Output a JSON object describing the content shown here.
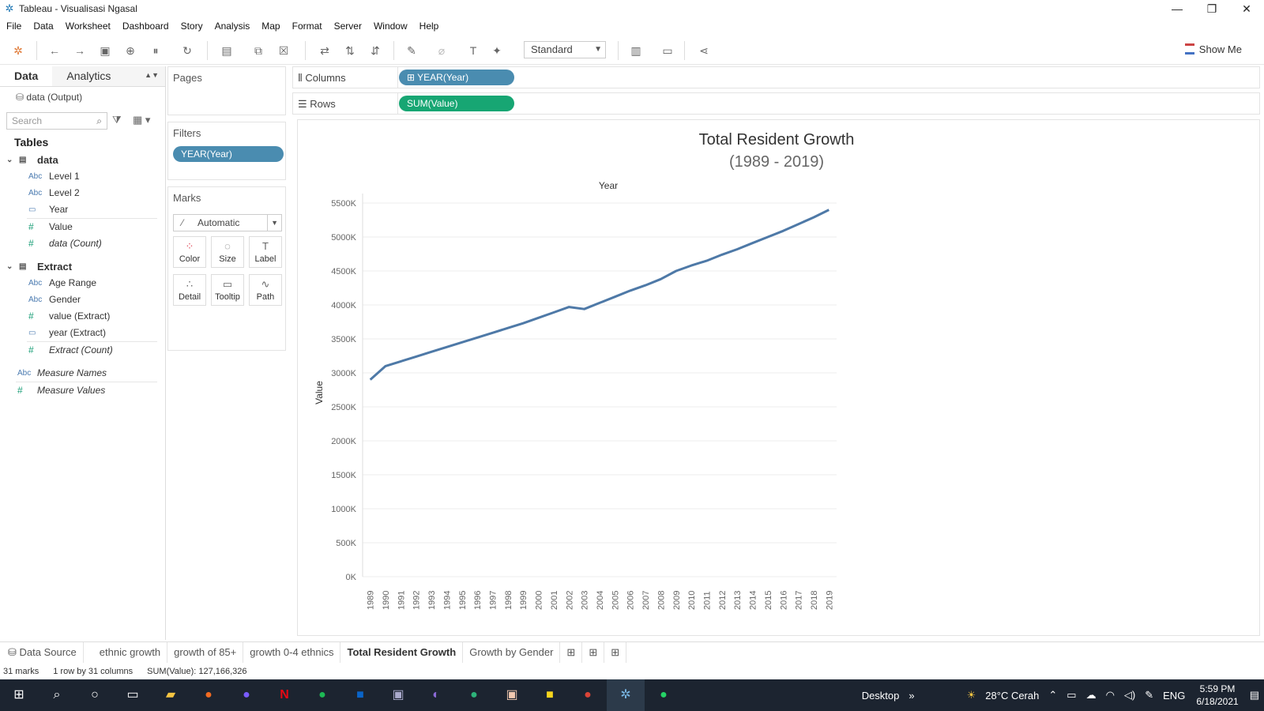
{
  "window": {
    "title": "Tableau - Visualisasi Ngasal",
    "controls": [
      "—",
      "❐",
      "✕"
    ]
  },
  "menu": [
    "File",
    "Data",
    "Worksheet",
    "Dashboard",
    "Story",
    "Analysis",
    "Map",
    "Format",
    "Server",
    "Window",
    "Help"
  ],
  "toolbar": {
    "view_mode": "Standard",
    "show_me": "Show Me"
  },
  "left": {
    "tab_data": "Data",
    "tab_analytics": "Analytics",
    "data_source": "data (Output)",
    "search_placeholder": "Search",
    "tables_heading": "Tables",
    "group1": {
      "name": "data",
      "fields": [
        {
          "type": "Abc",
          "name": "Level 1"
        },
        {
          "type": "Abc",
          "name": "Level 2"
        },
        {
          "type": "date",
          "name": "Year"
        },
        {
          "type": "#",
          "name": "Value"
        },
        {
          "type": "#",
          "name": "data (Count)"
        }
      ]
    },
    "group2": {
      "name": "Extract",
      "fields": [
        {
          "type": "Abc",
          "name": "Age Range"
        },
        {
          "type": "Abc",
          "name": "Gender"
        },
        {
          "type": "#",
          "name": "value (Extract)"
        },
        {
          "type": "date",
          "name": "year (Extract)"
        },
        {
          "type": "#",
          "name": "Extract (Count)"
        }
      ]
    },
    "measure_names": "Measure Names",
    "measure_values": "Measure Values"
  },
  "cards": {
    "pages": "Pages",
    "filters": "Filters",
    "filter_pill": "YEAR(Year)",
    "marks": "Marks",
    "mark_type": "Automatic",
    "mark_buttons": [
      "Color",
      "Size",
      "Label",
      "Detail",
      "Tooltip",
      "Path"
    ]
  },
  "shelves": {
    "columns_label": "Columns",
    "columns_pill": "YEAR(Year)",
    "rows_label": "Rows",
    "rows_pill": "SUM(Value)"
  },
  "chart_data": {
    "type": "line",
    "title": "Total Resident Growth",
    "subtitle": "(1989 - 2019)",
    "xlabel": "Year",
    "ylabel": "Value",
    "y_ticks": [
      "5500K",
      "5000K",
      "4500K",
      "4000K",
      "3500K",
      "3000K",
      "2500K",
      "2000K",
      "1500K",
      "1000K",
      "500K",
      "0K"
    ],
    "ylim": [
      0,
      5500000
    ],
    "x": [
      1989,
      1990,
      1991,
      1992,
      1993,
      1994,
      1995,
      1996,
      1997,
      1998,
      1999,
      2000,
      2001,
      2002,
      2003,
      2004,
      2005,
      2006,
      2007,
      2008,
      2009,
      2010,
      2011,
      2012,
      2013,
      2014,
      2015,
      2016,
      2017,
      2018,
      2019
    ],
    "series": [
      {
        "values": [
          2900000,
          3100000,
          3170000,
          3240000,
          3310000,
          3380000,
          3450000,
          3520000,
          3590000,
          3660000,
          3730000,
          3810000,
          3890000,
          3970000,
          3940000,
          4030000,
          4120000,
          4210000,
          4290000,
          4380000,
          4500000,
          4580000,
          4650000,
          4740000,
          4820000,
          4910000,
          5000000,
          5090000,
          5190000,
          5290000,
          5400000
        ]
      }
    ],
    "line_color": "#4e79a7"
  },
  "sheets": [
    "Data Source",
    "ethnic growth",
    "growth of 85+",
    "growth 0-4 ethnics",
    "Total Resident Growth",
    "Growth by Gender"
  ],
  "active_sheet": "Total Resident Growth",
  "status": {
    "marks": "31 marks",
    "dims": "1 row by 31 columns",
    "sum": "SUM(Value): 127,166,326"
  },
  "taskbar": {
    "desktop": "Desktop",
    "weather": "28°C  Cerah",
    "lang": "ENG",
    "time": "5:59 PM",
    "date": "6/18/2021"
  }
}
